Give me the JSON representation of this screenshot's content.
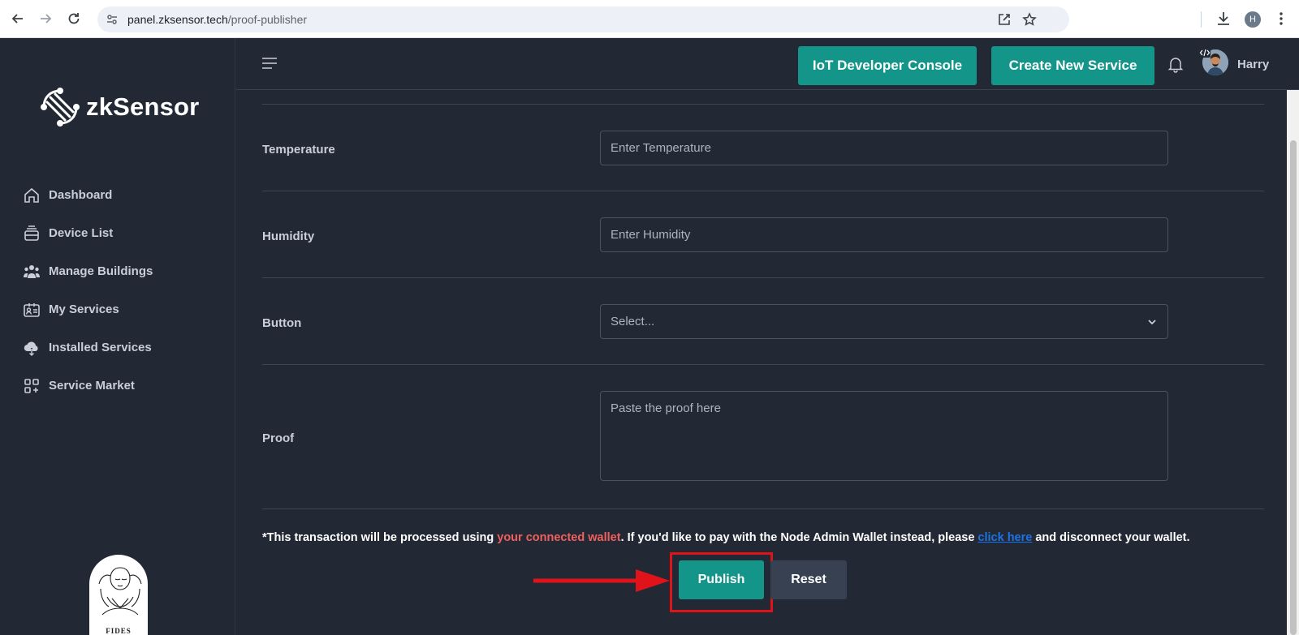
{
  "browser": {
    "url_host": "panel.zksensor.tech",
    "url_path": "/proof-publisher",
    "profile_initial": "H"
  },
  "sidebar": {
    "logo_text": "zkSensor",
    "items": [
      {
        "label": "Dashboard",
        "icon": "home-icon"
      },
      {
        "label": "Device List",
        "icon": "device-list-icon"
      },
      {
        "label": "Manage Buildings",
        "icon": "users-icon"
      },
      {
        "label": "My Services",
        "icon": "id-card-icon"
      },
      {
        "label": "Installed Services",
        "icon": "cloud-download-icon"
      },
      {
        "label": "Service Market",
        "icon": "grid-plus-icon"
      }
    ],
    "badge_text": "FIDES"
  },
  "header": {
    "console_button": "IoT Developer Console",
    "create_button": "Create New Service",
    "username": "Harry"
  },
  "form": {
    "temperature": {
      "label": "Temperature",
      "placeholder": "Enter Temperature"
    },
    "humidity": {
      "label": "Humidity",
      "placeholder": "Enter Humidity"
    },
    "button": {
      "label": "Button",
      "selected": "Select..."
    },
    "proof": {
      "label": "Proof",
      "placeholder": "Paste the proof here"
    }
  },
  "notice": {
    "prefix": "*This transaction will be processed using ",
    "highlight": "your connected wallet",
    "middle": ". If you'd like to pay with the Node Admin Wallet instead, please ",
    "link": "click here",
    "suffix": " and disconnect your wallet."
  },
  "actions": {
    "publish": "Publish",
    "reset": "Reset"
  },
  "colors": {
    "accent": "#14958a",
    "background": "#222935",
    "warning": "#f25f5c",
    "annotation": "#e0131a"
  }
}
